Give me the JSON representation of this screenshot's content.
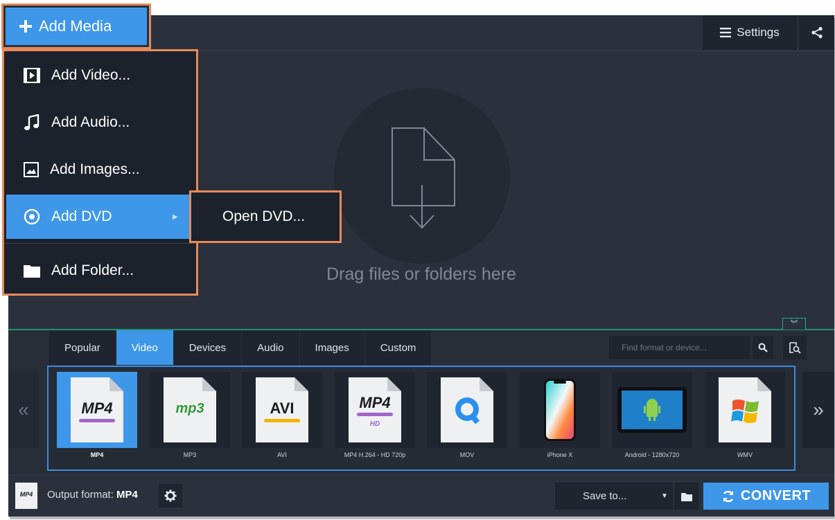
{
  "header": {
    "add_media_label": "Add Media",
    "settings_label": "Settings"
  },
  "add_menu": {
    "items": [
      {
        "label": "Add Video...",
        "icon": "video-file-icon"
      },
      {
        "label": "Add Audio...",
        "icon": "music-note-icon"
      },
      {
        "label": "Add Images...",
        "icon": "image-icon"
      },
      {
        "label": "Add DVD",
        "icon": "dvd-disc-icon",
        "active": true
      },
      {
        "label": "Add Folder...",
        "icon": "folder-icon"
      }
    ],
    "submenu": {
      "label": "Open DVD..."
    }
  },
  "dropzone": {
    "text": "Drag files or folders here"
  },
  "format_panel": {
    "tabs": [
      "Popular",
      "Video",
      "Devices",
      "Audio",
      "Images",
      "Custom"
    ],
    "active_tab": "Video",
    "search_placeholder": "Find format or device...",
    "presets": [
      {
        "label": "MP4",
        "badge": "MP4",
        "selected": true
      },
      {
        "label": "MP3",
        "badge": "mp3"
      },
      {
        "label": "AVI",
        "badge": "AVI"
      },
      {
        "label": "MP4 H.264 - HD 720p",
        "badge": "MP4",
        "sub": "HD"
      },
      {
        "label": "MOV",
        "badge": "Q"
      },
      {
        "label": "iPhone X",
        "badge": ""
      },
      {
        "label": "Android - 1280x720",
        "badge": ""
      },
      {
        "label": "WMV",
        "badge": ""
      }
    ]
  },
  "footer": {
    "output_label": "Output format:",
    "output_value": "MP4",
    "save_to_label": "Save to...",
    "convert_label": "CONVERT"
  },
  "colors": {
    "accent": "#3e97e8",
    "highlight_outline": "#e78b5c",
    "background": "#2a313c"
  }
}
